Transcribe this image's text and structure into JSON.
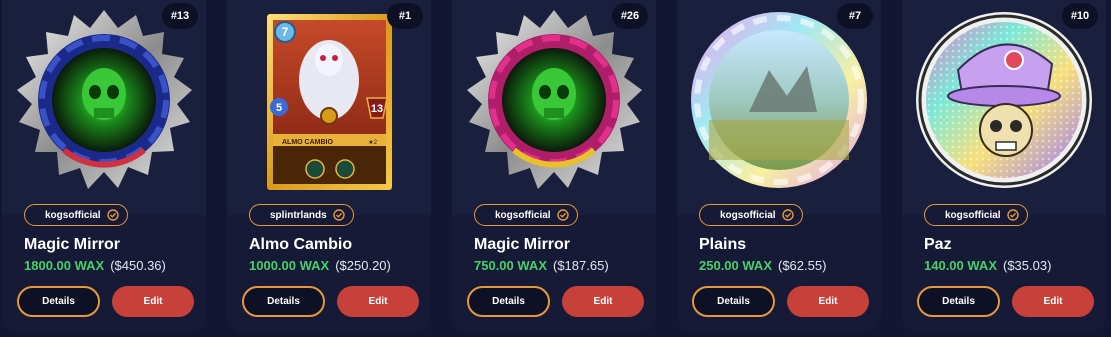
{
  "cards": [
    {
      "rank": "#13",
      "creator": "kogsofficial",
      "name": "Magic Mirror",
      "price_wax": "1800.00 WAX",
      "price_usd": "($450.36)",
      "details_label": "Details",
      "edit_label": "Edit"
    },
    {
      "rank": "#1",
      "creator": "splintrlands",
      "name": "Almo Cambio",
      "price_wax": "1000.00 WAX",
      "price_usd": "($250.20)",
      "details_label": "Details",
      "edit_label": "Edit",
      "card_art": {
        "mana": "7",
        "attack": "5",
        "health": "13",
        "title": "ALMO CAMBIO",
        "level": "★2"
      }
    },
    {
      "rank": "#26",
      "creator": "kogsofficial",
      "name": "Magic Mirror",
      "price_wax": "750.00 WAX",
      "price_usd": "($187.65)",
      "details_label": "Details",
      "edit_label": "Edit"
    },
    {
      "rank": "#7",
      "creator": "kogsofficial",
      "name": "Plains",
      "price_wax": "250.00 WAX",
      "price_usd": "($62.55)",
      "details_label": "Details",
      "edit_label": "Edit"
    },
    {
      "rank": "#10",
      "creator": "kogsofficial",
      "name": "Paz",
      "price_wax": "140.00 WAX",
      "price_usd": "($35.03)",
      "details_label": "Details",
      "edit_label": "Edit"
    }
  ],
  "colors": {
    "page_bg": "#121632",
    "card_bg": "#1b1f3e",
    "wax_green": "#46d168",
    "accent_orange": "#e49a3c",
    "edit_red": "#c8403a"
  }
}
